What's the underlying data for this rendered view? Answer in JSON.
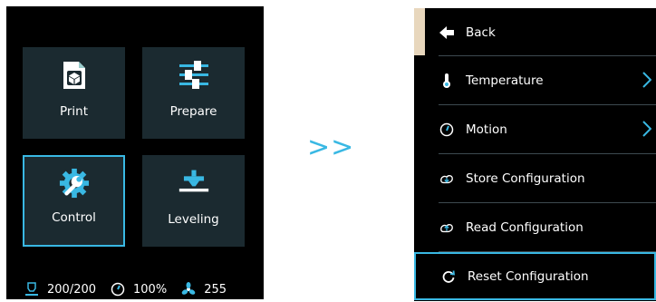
{
  "main_menu": {
    "tiles": [
      {
        "label": "Print"
      },
      {
        "label": "Prepare"
      },
      {
        "label": "Control"
      },
      {
        "label": "Leveling"
      }
    ]
  },
  "status_bar": {
    "temperature": "200/200",
    "speed": "100%",
    "fan": "255"
  },
  "transition_symbol": ">>",
  "control_menu": {
    "back_label": "Back",
    "items": [
      {
        "label": "Temperature",
        "has_submenu": true
      },
      {
        "label": "Motion",
        "has_submenu": true
      },
      {
        "label": "Store Configuration",
        "has_submenu": false
      },
      {
        "label": "Read Configuration",
        "has_submenu": false
      },
      {
        "label": "Reset Configuration",
        "has_submenu": false
      }
    ]
  },
  "colors": {
    "accent": "#39b8e3",
    "tile_bg": "#1b2a30",
    "back_accent": "#e8d7bd"
  }
}
